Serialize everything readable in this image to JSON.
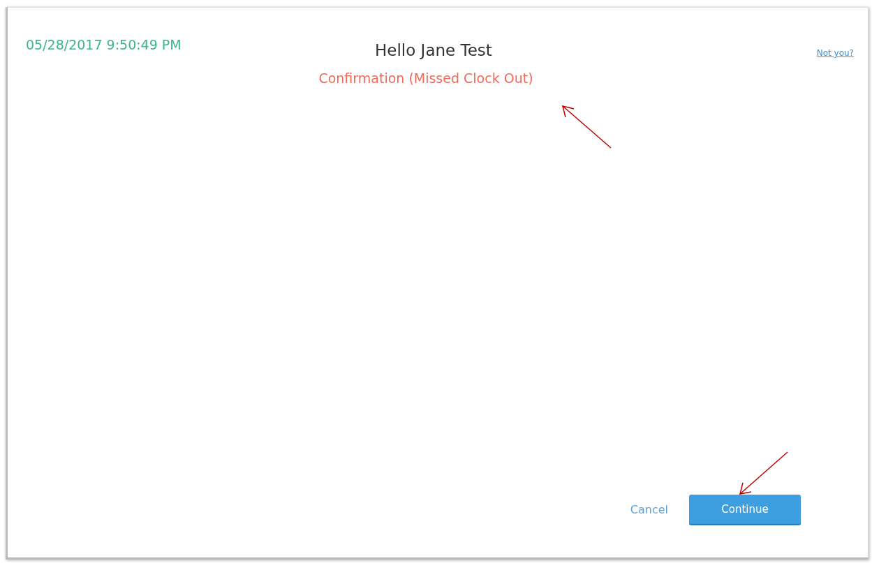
{
  "header": {
    "datetime": "05/28/2017 9:50:49 PM",
    "greeting": "Hello Jane Test",
    "not_you_link": "Not you?"
  },
  "subtitle": "Confirmation (Missed Clock Out)",
  "buttons": [
    {
      "label": "Cancel",
      "kind": "link"
    },
    {
      "label": "Continue",
      "kind": "primary"
    }
  ]
}
